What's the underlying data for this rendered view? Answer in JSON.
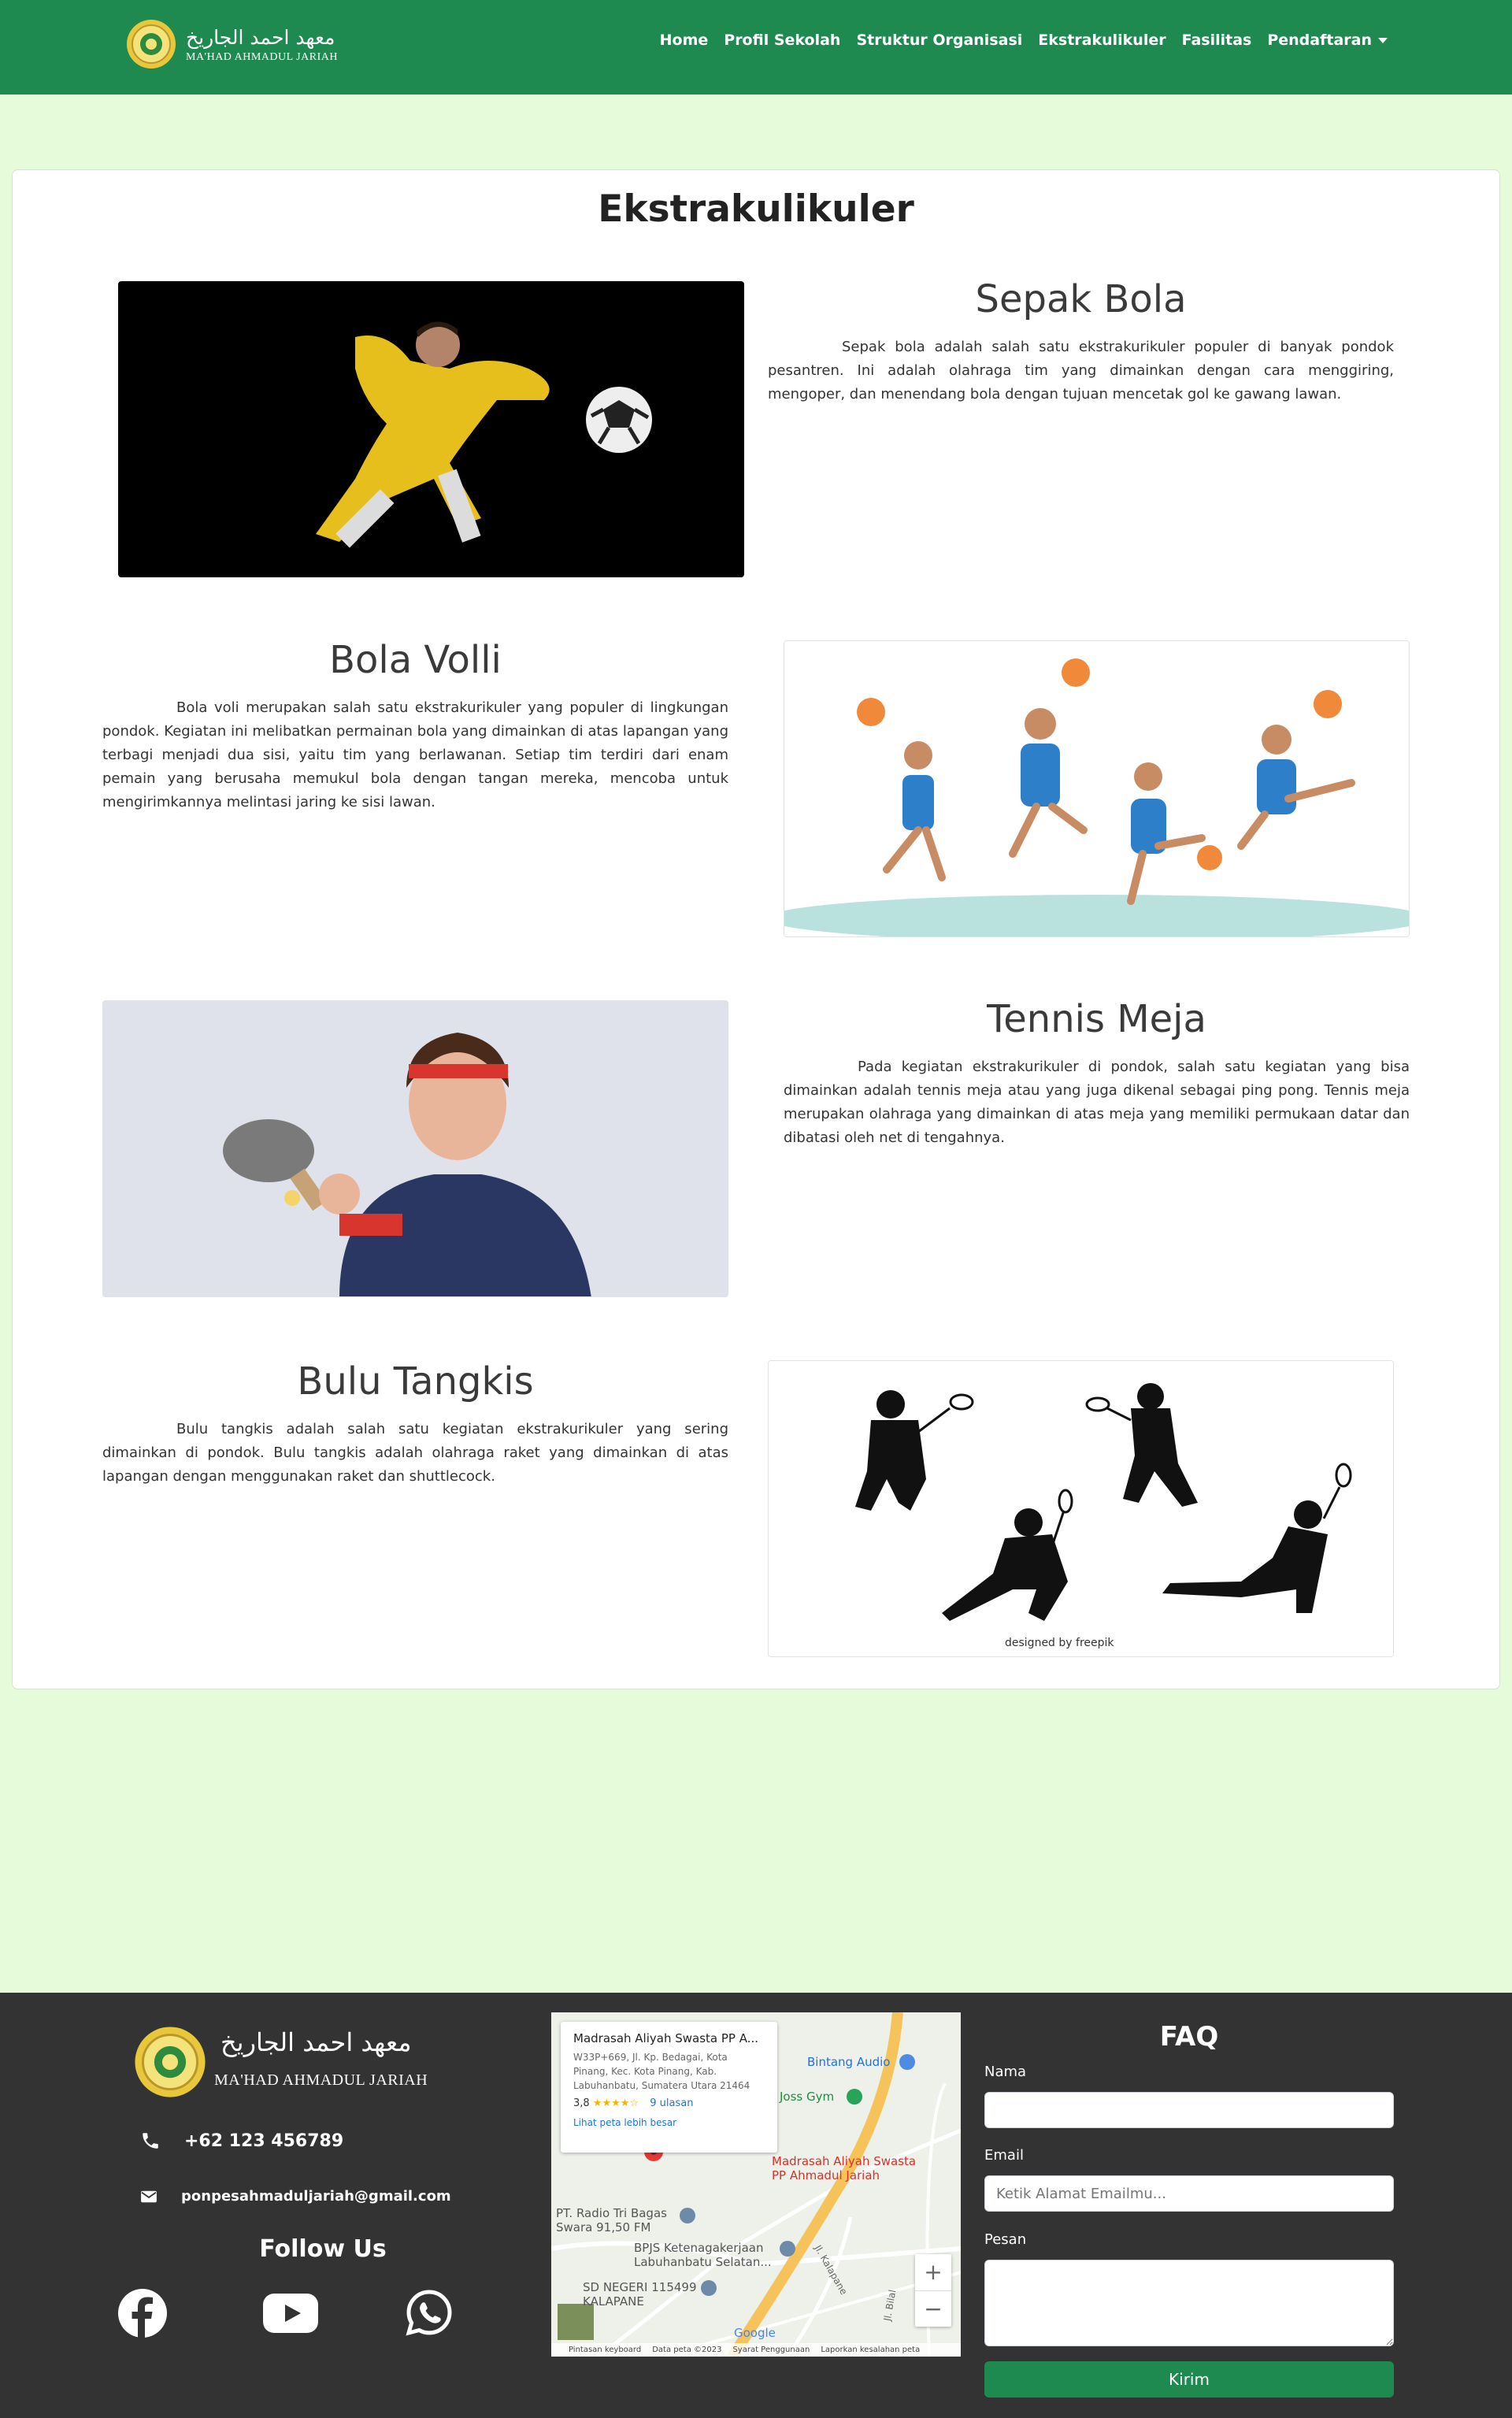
{
  "nav": {
    "brand_arabic": "معهد احمد الجاريخ",
    "brand_latin": "MA'HAD AHMADUL JARIAH",
    "items": [
      "Home",
      "Profil Sekolah",
      "Struktur Organisasi",
      "Ekstrakulikuler",
      "Fasilitas",
      "Pendaftaran"
    ]
  },
  "page": {
    "title": "Ekstrakulikuler"
  },
  "sections": [
    {
      "title": "Sepak Bola",
      "text": "Sepak bola adalah salah satu ekstrakurikuler populer di banyak pondok pesantren. Ini adalah olahraga tim yang dimainkan dengan cara menggiring, mengoper, dan menendang bola dengan tujuan mencetak gol ke gawang lawan."
    },
    {
      "title": "Bola Volli",
      "text": "Bola voli merupakan salah satu ekstrakurikuler yang populer di lingkungan pondok. Kegiatan ini melibatkan permainan bola yang dimainkan di atas lapangan yang terbagi menjadi dua sisi, yaitu tim yang berlawanan. Setiap tim terdiri dari enam pemain yang berusaha memukul bola dengan tangan mereka, mencoba untuk mengirimkannya melintasi jaring ke sisi lawan."
    },
    {
      "title": "Tennis Meja",
      "text": "Pada kegiatan ekstrakurikuler di pondok, salah satu kegiatan yang bisa dimainkan adalah tennis meja atau yang juga dikenal sebagai ping pong. Tennis meja merupakan olahraga yang dimainkan di atas meja yang memiliki permukaan datar dan dibatasi oleh net di tengahnya."
    },
    {
      "title": "Bulu Tangkis",
      "text": "Bulu tangkis adalah salah satu kegiatan ekstrakurikuler yang sering dimainkan di pondok. Bulu tangkis adalah olahraga raket yang dimainkan di atas lapangan dengan menggunakan raket dan shuttlecock."
    }
  ],
  "images": {
    "freepik": "designed by freepik"
  },
  "footer": {
    "arabic": "معهد احمد الجاريخ",
    "latin": "MA'HAD AHMADUL JARIAH",
    "phone": "+62 123 456789",
    "email": "ponpesahmaduljariah@gmail.com",
    "follow": "Follow Us"
  },
  "map": {
    "card_title": "Madrasah Aliyah Swasta PP A...",
    "card_address": "W33P+669, Jl. Kp. Bedagai, Kota Pinang, Kec. Kota Pinang, Kab. Labuhanbatu, Sumatera Utara 21464",
    "rating": "3,8",
    "stars": "★★★★☆",
    "reviews": "9 ulasan",
    "larger_link": "Lihat peta lebih besar",
    "labels": [
      "Bintang Audio",
      "Joss Gym",
      "Madrasah Aliyah Swasta PP Ahmadul Jariah",
      "PT. Radio Tri Bagas Swara 91,50 FM",
      "BPJS Ketenagakerjaan Labuhanbatu Selatan...",
      "SD NEGERI 115499 KALAPANE",
      "Jl. Kalapane",
      "Jl. Bilal"
    ],
    "zoom_in": "+",
    "zoom_out": "−",
    "google": "Google",
    "attribution": [
      "Pintasan keyboard",
      "Data peta ©2023",
      "Syarat Penggunaan",
      "Laporkan kesalahan peta"
    ]
  },
  "faq": {
    "title": "FAQ",
    "name_label": "Nama",
    "name_value": "",
    "email_label": "Email",
    "email_placeholder": "Ketik Alamat Emailmu...",
    "message_label": "Pesan",
    "message_value": "",
    "submit": "Kirim"
  },
  "colors": {
    "nav": "#1f8a50",
    "page_bg": "#e6fbd9",
    "footer": "#333333",
    "button": "#1f8a50"
  }
}
